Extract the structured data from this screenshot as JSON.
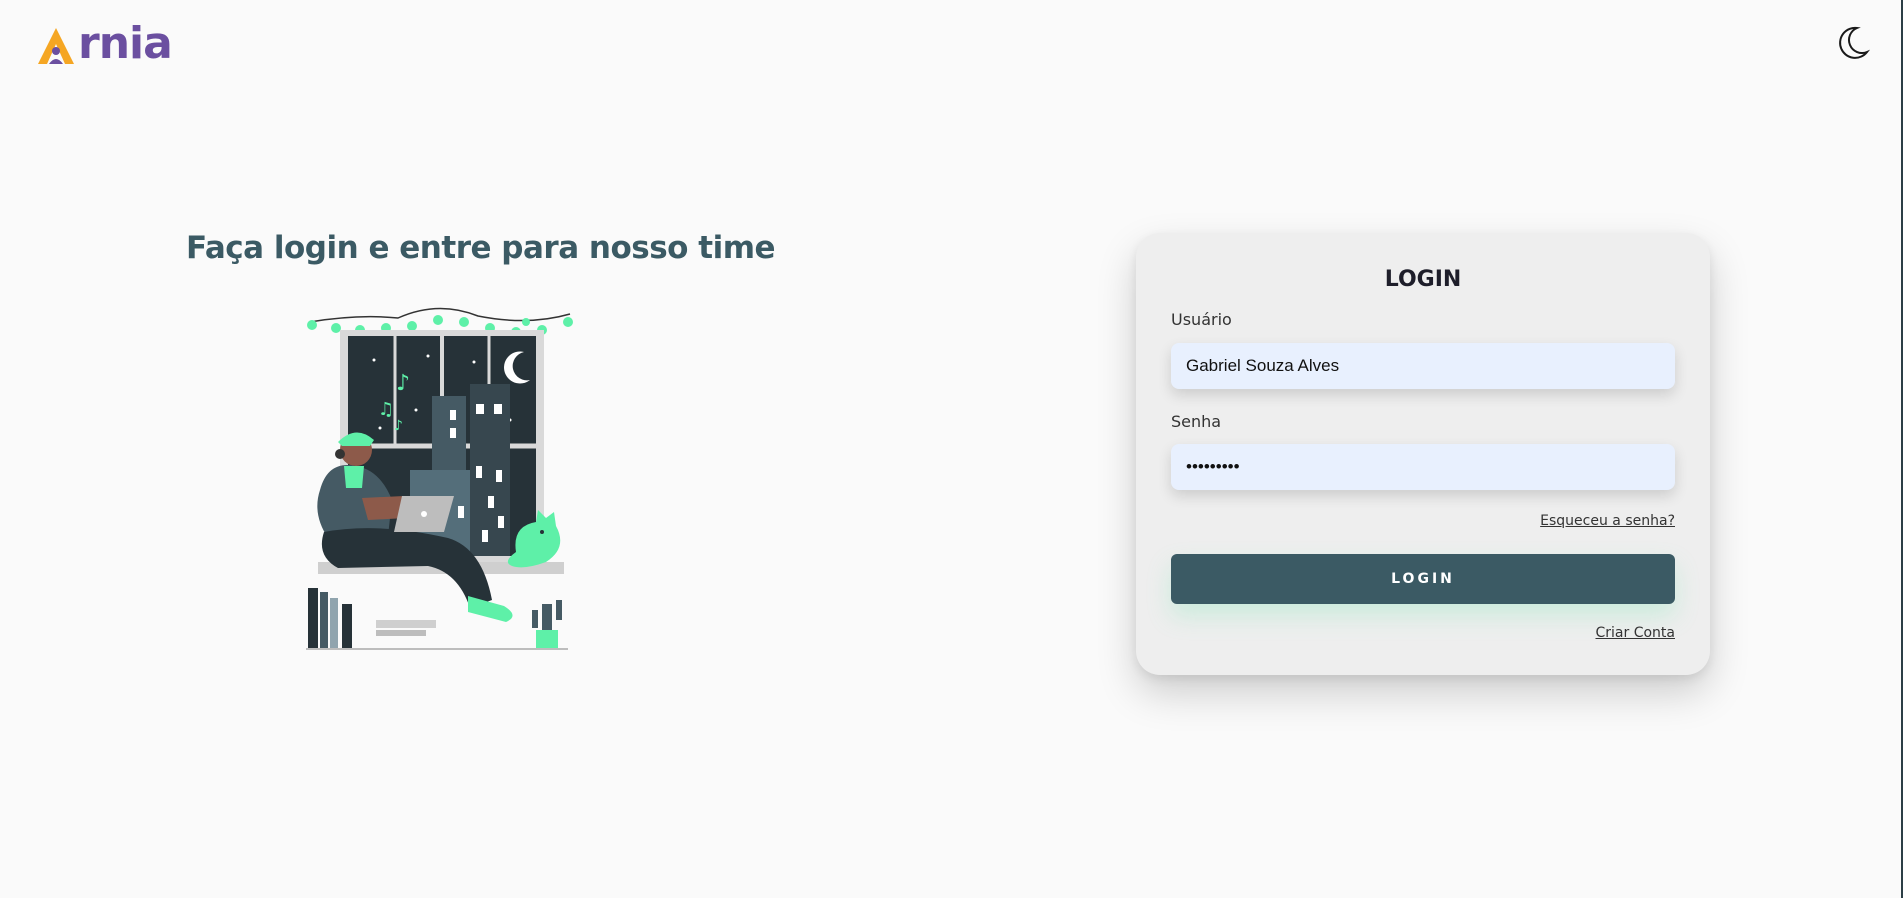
{
  "header": {
    "logo_text": "Arnia",
    "logo_rest": "rnia",
    "theme_icon": "moon-icon"
  },
  "hero": {
    "title": "Faça login e entre para nosso time",
    "illustration": "person-with-laptop-at-window"
  },
  "login_form": {
    "title": "LOGIN",
    "username_label": "Usuário",
    "username_value": "Gabriel Souza Alves",
    "password_label": "Senha",
    "password_value": "•••••••••",
    "forgot_link": "Esqueceu a senha?",
    "submit_label": "LOGIN",
    "signup_link": "Criar Conta"
  },
  "colors": {
    "brand_orange": "#f5a623",
    "brand_purple": "#6b4fa0",
    "primary": "#3b5a64",
    "accent_green": "#5ef0a8",
    "input_bg": "#e8f0fe"
  }
}
